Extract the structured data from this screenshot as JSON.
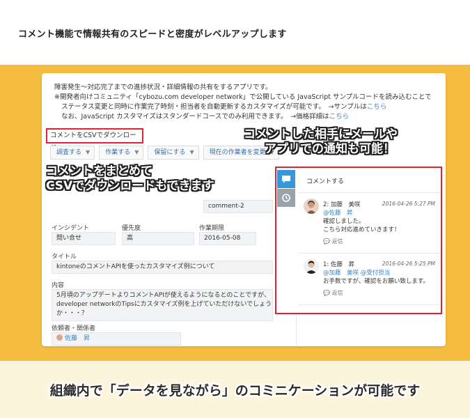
{
  "heading": "コメント機能で情報共有のスピードと密度がレベルアップします",
  "app": {
    "description": {
      "line1": "障害発生～対応完了までの進捗状況・詳細情報の共有をするアプリです。",
      "line2": "※開発者向けコミュニティ「cybozu.com developer network」で公開している JavaScript サンプルコードを読み込むことで、",
      "line3_prefix": "ステータス変更と同時に作業完了時刻・担当者を自動更新するカスタマイズが可能です。　→サンプルは",
      "line3_link": "こちら",
      "line4_prefix": "なお、JavaScript カスタマイズはスタンダードコースでのみ利用できます。　→価格詳細は",
      "line4_link": "こちら"
    },
    "csv_button": "コメントをCSVでダウンロード",
    "actions": [
      {
        "label": "調査する"
      },
      {
        "label": "作業する"
      },
      {
        "label": "保留にする"
      },
      {
        "label": "現在の作業者を変更"
      }
    ],
    "record": {
      "comment_field_value": "comment-2",
      "incident_label": "インシデント",
      "incident_value": "問い合せ",
      "priority_label": "優先度",
      "priority_value": "高",
      "deadline_label": "作業期限",
      "deadline_value": "2016-05-08",
      "title_label": "タイトル",
      "title_value": "kintoneのコメントAPIを使ったカスタマイズ例について",
      "content_label": "内容",
      "content_line1": "5月頃のアップデートよりコメントAPIが使えるようになるとのことですが、",
      "content_line2": "developer networkのTipsにカスタマイズ例を上げていただけないでしょう",
      "content_line3": "か・・・？",
      "requester_label": "依頼者・関係者",
      "requester_value": "佐藤　昇"
    },
    "comments": {
      "input_label": "コメントする",
      "items": [
        {
          "number_author": "2: 加藤　美咲",
          "date": "2016-04-26 5:27 PM",
          "mention": "@佐藤　昇",
          "body_line1": "確認しました。",
          "body_line2": "こちら対応進めていきます！",
          "reply": "返信"
        },
        {
          "number_author": "1: 佐藤　昇",
          "date": "2016-04-26 5:25 PM",
          "mention": "@加藤　美咲 @受付担当",
          "body_line1": "お手数ですが、確認をお願い致します。",
          "reply": "返信"
        }
      ]
    }
  },
  "callouts": {
    "left_line1": "コメントをまとめて",
    "left_line2": "CSVでダウンロードもできます",
    "right_line1": "コメントした相手にメールや",
    "right_line2": "アプリでの通知も可能！"
  },
  "bottom_caption": "組織内で「データを見ながら」のコミニケーションが可能です",
  "colors": {
    "yellow": "#f5bd3f",
    "cream": "#fdf4dc",
    "highlight_red": "#e2222a",
    "active_tab_blue": "#3498db",
    "link_blue": "#3b82c4"
  }
}
